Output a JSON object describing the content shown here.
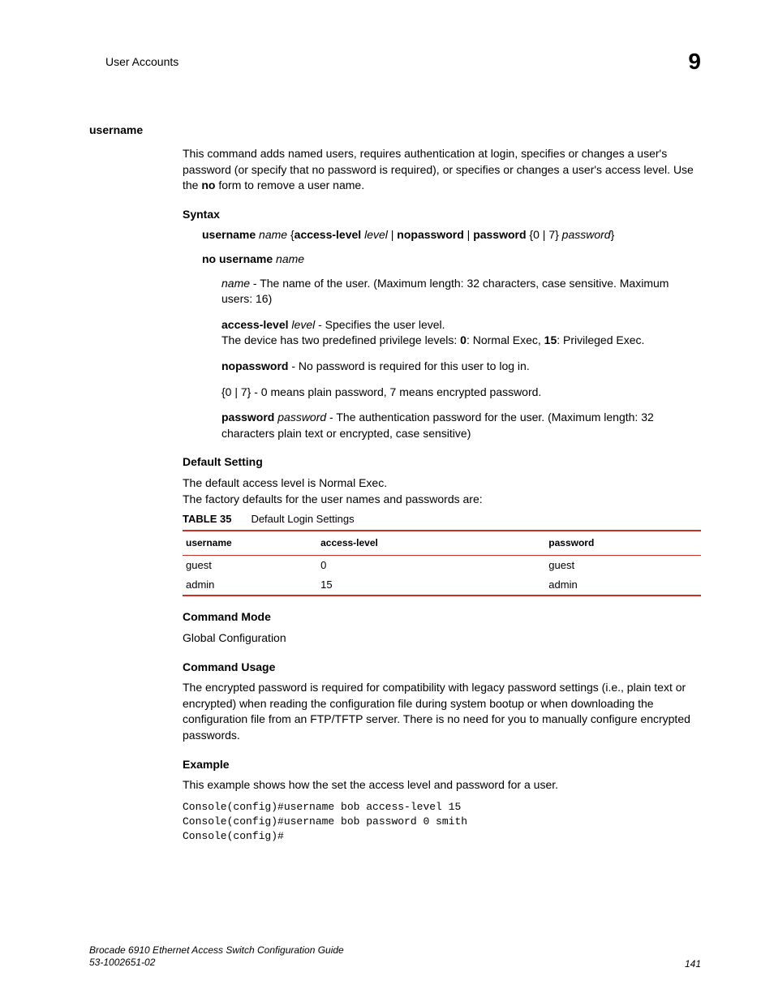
{
  "header": {
    "section": "User Accounts",
    "chapter": "9"
  },
  "command": {
    "name": "username",
    "description_parts": {
      "p1": "This command adds named users, requires authentication at login, specifies or changes a user's password (or specify that no password is required), or specifies or changes a user's access level. Use the ",
      "no": "no",
      "p2": " form to remove a user name."
    }
  },
  "syntax": {
    "heading": "Syntax",
    "line1": {
      "username": "username",
      "name": "name",
      "lbrace": " {",
      "access_level": "access-level",
      "level": "level",
      "pipe1": " | ",
      "nopassword": "nopassword",
      "pipe2": " | ",
      "password": "password",
      "options": " {0 | 7}",
      "password_arg": "password",
      "rbrace": "}"
    },
    "line2": {
      "no_username": "no username",
      "name": "name"
    },
    "param_name": {
      "name": "name",
      "text": " - The name of the user. (Maximum length: 32 characters, case sensitive. Maximum users: 16)"
    },
    "param_access": {
      "label": "access-level",
      "level": "level",
      "text1": " - Specifies the user level.",
      "text2a": "The device has two predefined privilege levels: ",
      "zero": "0",
      "text2b": ": Normal Exec, ",
      "fifteen": "15",
      "text2c": ": Privileged Exec."
    },
    "param_nopassword": {
      "label": "nopassword",
      "text": " - No password is required for this user to log in."
    },
    "param_07": {
      "label": "{0 | 7}",
      "text": " - 0 means plain password, 7 means encrypted password."
    },
    "param_password": {
      "label": "password",
      "arg": "password",
      "text": " - The authentication password for the user. (Maximum length: 32 characters plain text or encrypted, case sensitive)"
    }
  },
  "default_setting": {
    "heading": "Default Setting",
    "line1": "The default access level is Normal Exec.",
    "line2": "The factory defaults for the user names and passwords are:"
  },
  "table": {
    "label": "TABLE 35",
    "title": "Default Login Settings",
    "headers": {
      "c1": "username",
      "c2": "access-level",
      "c3": "password"
    },
    "rows": [
      {
        "c1": "guest",
        "c2": "0",
        "c3": "guest"
      },
      {
        "c1": "admin",
        "c2": "15",
        "c3": "admin"
      }
    ]
  },
  "command_mode": {
    "heading": "Command Mode",
    "text": "Global Configuration"
  },
  "command_usage": {
    "heading": "Command Usage",
    "text": "The encrypted password is required for compatibility with legacy password settings (i.e., plain text or encrypted) when reading the configuration file during system bootup or when downloading the configuration file from an FTP/TFTP server. There is no need for you to manually configure encrypted passwords."
  },
  "example": {
    "heading": "Example",
    "intro": "This example shows how the set the access level and password for a user.",
    "code": "Console(config)#username bob access-level 15\nConsole(config)#username bob password 0 smith\nConsole(config)#"
  },
  "footer": {
    "title": "Brocade 6910 Ethernet Access Switch Configuration Guide",
    "docnum": "53-1002651-02",
    "page": "141"
  }
}
